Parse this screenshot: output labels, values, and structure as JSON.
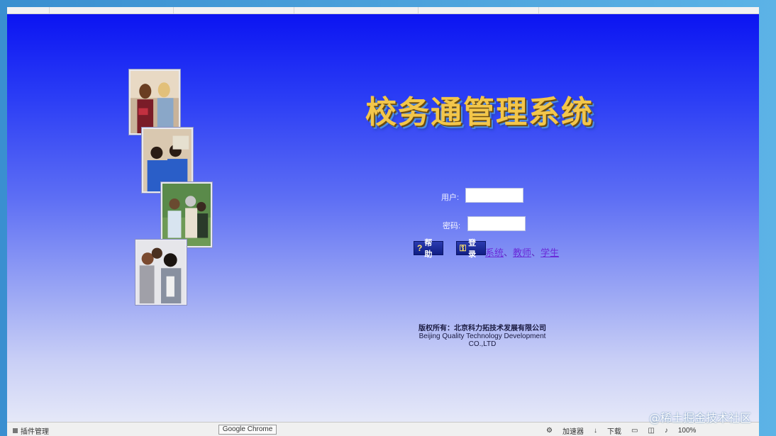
{
  "app": {
    "title": "校务通管理系统"
  },
  "login": {
    "user_label": "用户:",
    "password_label": "密码:",
    "user_value": "",
    "password_value": "",
    "help_button": "帮助",
    "login_button": "登录",
    "roles": [
      "系统",
      "教师",
      "学生"
    ],
    "role_separator": "、"
  },
  "footer": {
    "copyright_cn": "版权所有：北京科力拓技术发展有限公司",
    "copyright_en": "Beijing Quality Technology Development CO.,LTD"
  },
  "statusbar": {
    "left_text": "插件管理",
    "center_text": "Google Chrome",
    "speed_label": "加速器",
    "download_label": "下载",
    "zoom": "100%"
  },
  "watermark": "@稀土掘金技术社区",
  "colors": {
    "title_gold": "#f3c64a",
    "page_top_blue": "#0b14f2",
    "button_blue": "#101e84",
    "link_purple": "#6a2ad8"
  },
  "icons": {
    "help": "question-mark-icon",
    "login": "key-icon"
  }
}
